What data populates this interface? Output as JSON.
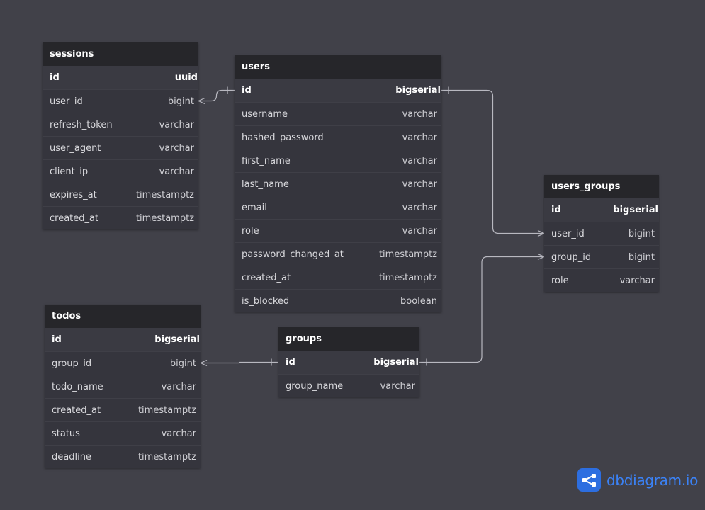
{
  "tables": {
    "sessions": {
      "name": "sessions",
      "columns": [
        {
          "name": "id",
          "type": "uuid",
          "pk": true
        },
        {
          "name": "user_id",
          "type": "bigint"
        },
        {
          "name": "refresh_token",
          "type": "varchar"
        },
        {
          "name": "user_agent",
          "type": "varchar"
        },
        {
          "name": "client_ip",
          "type": "varchar"
        },
        {
          "name": "expires_at",
          "type": "timestamptz"
        },
        {
          "name": "created_at",
          "type": "timestamptz"
        }
      ]
    },
    "users": {
      "name": "users",
      "columns": [
        {
          "name": "id",
          "type": "bigserial",
          "pk": true
        },
        {
          "name": "username",
          "type": "varchar"
        },
        {
          "name": "hashed_password",
          "type": "varchar"
        },
        {
          "name": "first_name",
          "type": "varchar"
        },
        {
          "name": "last_name",
          "type": "varchar"
        },
        {
          "name": "email",
          "type": "varchar"
        },
        {
          "name": "role",
          "type": "varchar"
        },
        {
          "name": "password_changed_at",
          "type": "timestamptz"
        },
        {
          "name": "created_at",
          "type": "timestamptz"
        },
        {
          "name": "is_blocked",
          "type": "boolean"
        }
      ]
    },
    "users_groups": {
      "name": "users_groups",
      "columns": [
        {
          "name": "id",
          "type": "bigserial",
          "pk": true
        },
        {
          "name": "user_id",
          "type": "bigint"
        },
        {
          "name": "group_id",
          "type": "bigint"
        },
        {
          "name": "role",
          "type": "varchar"
        }
      ]
    },
    "todos": {
      "name": "todos",
      "columns": [
        {
          "name": "id",
          "type": "bigserial",
          "pk": true
        },
        {
          "name": "group_id",
          "type": "bigint"
        },
        {
          "name": "todo_name",
          "type": "varchar"
        },
        {
          "name": "created_at",
          "type": "timestamptz"
        },
        {
          "name": "status",
          "type": "varchar"
        },
        {
          "name": "deadline",
          "type": "timestamptz"
        }
      ]
    },
    "groups": {
      "name": "groups",
      "columns": [
        {
          "name": "id",
          "type": "bigserial",
          "pk": true
        },
        {
          "name": "group_name",
          "type": "varchar"
        }
      ]
    }
  },
  "relationships": [
    {
      "from": "sessions.user_id",
      "to": "users.id",
      "from_card": "many",
      "to_card": "one"
    },
    {
      "from": "users_groups.user_id",
      "to": "users.id",
      "from_card": "many",
      "to_card": "one"
    },
    {
      "from": "users_groups.group_id",
      "to": "groups.id",
      "from_card": "many",
      "to_card": "one"
    },
    {
      "from": "todos.group_id",
      "to": "groups.id",
      "from_card": "many",
      "to_card": "one"
    }
  ],
  "logo": {
    "text": "dbdiagram",
    "suffix": ".io"
  },
  "colors": {
    "background": "#414149",
    "table_body": "#35353d",
    "table_header": "#26262a",
    "connector": "#b8b8c0",
    "brand": "#3b82f6"
  }
}
